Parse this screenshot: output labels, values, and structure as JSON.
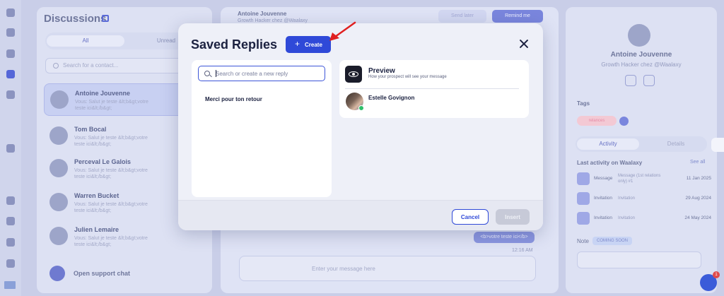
{
  "background": {
    "discussions": {
      "title": "Discussions",
      "tabs": [
        "All",
        "Unread"
      ],
      "search_placeholder": "Search for a contact...",
      "conversations": [
        {
          "name": "Antoine Jouvenne",
          "preview": "Vous: Salut je teste &lt;b&gt;votre teste ici&lt;/b&gt;",
          "selected": true
        },
        {
          "name": "Tom Bocal",
          "preview": "Vous: Salut je teste &lt;b&gt;votre teste ici&lt;/b&gt;",
          "selected": false
        },
        {
          "name": "Perceval Le Galois",
          "preview": "Vous: Salut je teste &lt;b&gt;votre teste ici&lt;/b&gt;",
          "selected": false
        },
        {
          "name": "Warren Bucket",
          "preview": "Vous: Salut je teste &lt;b&gt;votre teste ici&lt;/b&gt;",
          "selected": false
        },
        {
          "name": "Julien Lemaire",
          "preview": "Vous: Salut je teste &lt;b&gt;votre teste ici&lt;/b&gt;",
          "selected": false
        }
      ],
      "support": "Open support chat"
    },
    "chat": {
      "contact_name": "Antoine Jouvenne",
      "contact_title": "Growth Hacker chez @Waalaxy",
      "send_later": "Send later",
      "remind_me": "Remind me",
      "bubble": "<b>votre teste ici</b>",
      "time": "12:16 AM",
      "composer_placeholder": "Enter your message here"
    },
    "profile": {
      "name": "Antoine Jouvenne",
      "title": "Growth Hacker chez @Waalaxy",
      "tags_label": "Tags",
      "tag": "relances",
      "tabs": [
        "Activity",
        "Details"
      ],
      "last_activity": "Last activity on Waalaxy",
      "see_all": "See all",
      "activities": [
        {
          "type": "Message",
          "desc": "Message (1st relations only) #1",
          "date": "11 Jan 2025"
        },
        {
          "type": "Invitation",
          "desc": "Invitation",
          "date": "29 Aug 2024"
        },
        {
          "type": "Invitation",
          "desc": "Invitation",
          "date": "24 May 2024"
        }
      ],
      "notes_label": "Note",
      "coming_soon": "COMING SOON"
    },
    "fab_badge": "1"
  },
  "modal": {
    "title": "Saved Replies",
    "create_label": "Create",
    "create_icon": "+",
    "search_placeholder": "Search or create a new reply",
    "replies": [
      "Merci pour ton retour"
    ],
    "preview": {
      "title": "Preview",
      "subtitle": "How your prospect will see your message",
      "prospect_name": "Estelle Govignon"
    },
    "cancel_label": "Cancel",
    "insert_label": "Insert"
  },
  "colors": {
    "primary": "#2f49d8",
    "annotation_arrow": "#e02020",
    "overlay": "#c9cee8"
  }
}
